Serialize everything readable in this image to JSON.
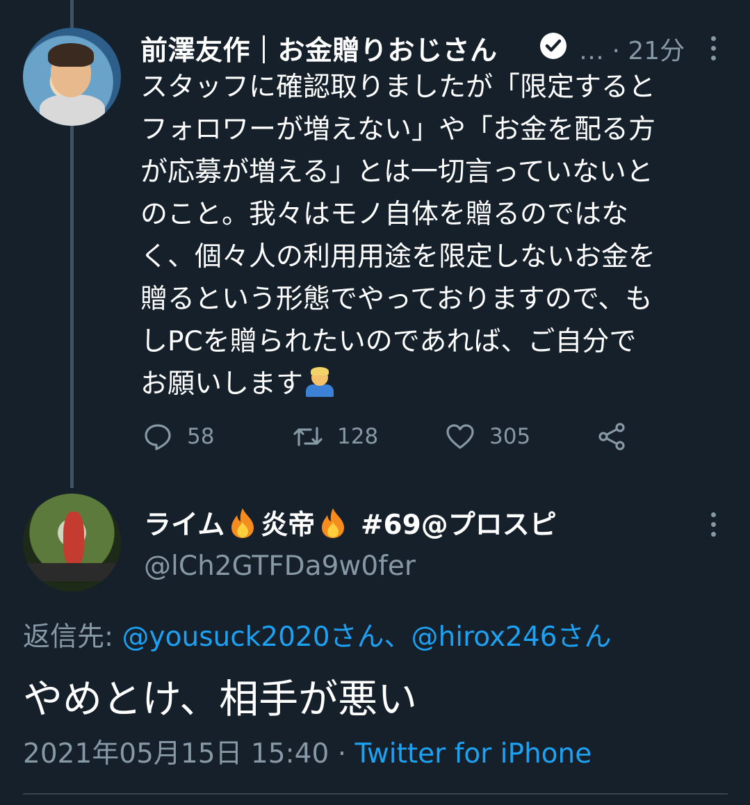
{
  "tweet1": {
    "author_name": "前澤友作｜お金贈りおじさん",
    "ellipsis": "…",
    "time": "· 21分",
    "lines": [
      "スタッフに確認取りましたが「限定すると",
      "フォロワーが増えない」や「お金を配る方",
      "が応募が増える」とは一切言っていないと",
      "のこと。我々はモノ自体を贈るのではな",
      "く、個々人の利用用途を限定しないお金を",
      "贈るという形態でやっておりますので、も",
      "しPCを贈られたいのであれば、ご自分で",
      "お願いします"
    ],
    "emoji": "man-bowing-emoji",
    "replies": "58",
    "retweets": "128",
    "likes": "305"
  },
  "tweet2": {
    "name_part1": "ライム",
    "name_part2": "炎帝",
    "name_part3": " #69@プロスピ",
    "handle": "@lCh2GTFDa9w0fer",
    "reply_label": "返信先: ",
    "reply_user1": "@yousuck2020さん",
    "reply_sep": "、",
    "reply_user2": "@hirox246さん",
    "body": "やめとけ、相手が悪い",
    "timestamp": "2021年05月15日 15:40 · ",
    "client": "Twitter for iPhone"
  },
  "colors": {
    "background": "#15202b",
    "text": "#ffffff",
    "secondary": "#8899a6",
    "link": "#1da1f2",
    "thread_line": "#3d5466"
  },
  "icons": [
    "verified-badge-icon",
    "more-options-icon",
    "reply-icon",
    "retweet-icon",
    "like-icon",
    "share-icon",
    "fire-emoji"
  ]
}
